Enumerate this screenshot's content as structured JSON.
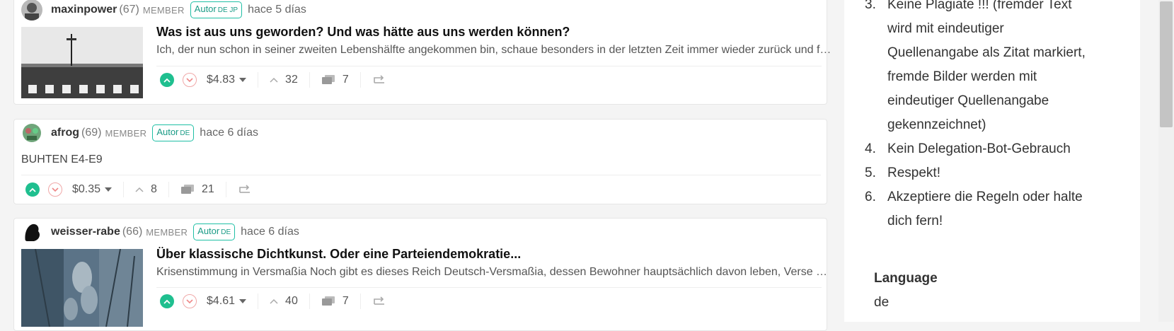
{
  "posts": [
    {
      "author": "maxinpower",
      "reputation": "(67)",
      "role": "MEMBER",
      "badge_text": "Autor",
      "badge_langs": "DE JP",
      "time": "hace 5 días",
      "title": "Was ist aus uns geworden? Und was hätte aus uns werden können?",
      "excerpt": "Ich, der nun schon in seiner zweiten Lebenshälfte angekommen bin, schaue besonders in der letzten Zeit immer wieder zurück und frage mich, was aus uns geworden ist.",
      "payout": "$4.83",
      "votes": "32",
      "comments": "7"
    },
    {
      "author": "afrog",
      "reputation": "(69)",
      "role": "MEMBER",
      "badge_text": "Autor",
      "badge_langs": "DE",
      "time": "hace 6 días",
      "body": "BUHTEN E4-E9",
      "payout": "$0.35",
      "votes": "8",
      "comments": "21"
    },
    {
      "author": "weisser-rabe",
      "reputation": "(66)",
      "role": "MEMBER",
      "badge_text": "Autor",
      "badge_langs": "DE",
      "time": "hace 6 días",
      "title": "Über klassische Dichtkunst. Oder eine Parteiendemokratie...",
      "excerpt": "Krisenstimmung in Versmaßia Noch gibt es dieses Reich Deutsch-Versmaßia, dessen Bewohner hauptsächlich davon leben, Verse zu schmieden.",
      "payout": "$4.61",
      "votes": "40",
      "comments": "7"
    }
  ],
  "sidebar": {
    "rules": [
      {
        "num": "3.",
        "lines": [
          "Keine Plagiate !!! (fremder Text",
          "wird mit eindeutiger",
          "Quellenangabe als Zitat markiert,",
          "fremde Bilder werden mit",
          "eindeutiger Quellenangabe",
          "gekennzeichnet)"
        ]
      },
      {
        "num": "4.",
        "lines": [
          "Kein Delegation-Bot-Gebrauch"
        ]
      },
      {
        "num": "5.",
        "lines": [
          "Respekt!"
        ]
      },
      {
        "num": "6.",
        "lines": [
          "Akzeptiere die Regeln oder halte",
          "dich fern!"
        ]
      }
    ],
    "language_label": "Language",
    "language_value": "de"
  },
  "colors": {
    "upvote": "#1fbf8f",
    "badge_border": "#1fbfa5",
    "downvote_border": "#f0a8a8"
  }
}
